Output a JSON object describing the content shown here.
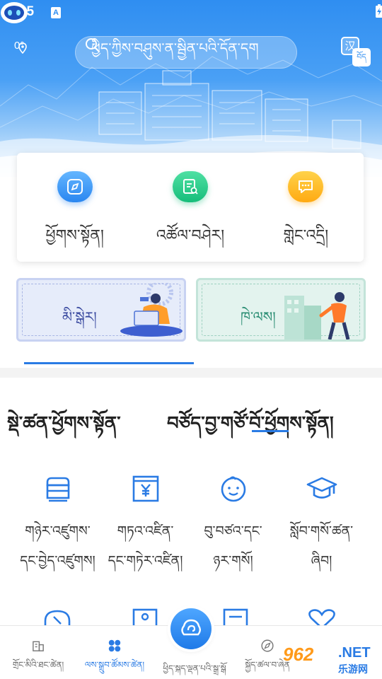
{
  "status_bar": {
    "time": "2:35",
    "app_icon_letter": "A"
  },
  "header": {
    "weather_temp": "0°",
    "search_placeholder": "ཕྱིད་ཀྱིས་བཤུས་ན་སྦྱིན་པའི་དོན་དག",
    "translate_zh": "汉",
    "translate_bo": "བོད"
  },
  "quick_access": [
    {
      "label": "ཕྱོགས་སྟོན།",
      "icon": "compass-icon"
    },
    {
      "label": "འཚོལ་བཤེར།",
      "icon": "document-search-icon"
    },
    {
      "label": "གླེང་འདྲི།",
      "icon": "chat-bubble-icon"
    }
  ],
  "banners": {
    "left_label": "མི་སྒེར།",
    "right_label": "ཁེ་ལས།"
  },
  "section_tabs": {
    "tab1": "སྡེ་ཚན་ཕྱོགས་སྟོན་",
    "tab2": "བཙོད་བྱ་གཙོ་བོ་ཕྱོགས་སྟོན།"
  },
  "services": [
    {
      "line1": "གཉེར་འཛུགས་",
      "line2": "དང་བྱེད་འཛུགས།",
      "icon": "storefront-icon"
    },
    {
      "line1": "གཏའ་འཛིན་",
      "line2": "དང་གཏེར་འཛིན།",
      "icon": "yuan-document-icon"
    },
    {
      "line1": "བུ་བཙའ་དང་",
      "line2": "ཉར་གསོ།",
      "icon": "baby-face-icon"
    },
    {
      "line1": "སློབ་གསོ་ཚན་",
      "line2": "ཞིབ།",
      "icon": "graduation-cap-icon"
    }
  ],
  "bottom_nav": {
    "item1": "གྲོང་མིའི་ཐང་ཚེན།",
    "item2": "ལས་སྒྲུབ་ཚོམས་ཚེན།",
    "center": "ཕྱིད་སྐད་ལྡན་པའི་སྒྲ་སྒོ",
    "item4": "སྐྱོད་ཚལ་བ་ཞེན"
  },
  "watermark": {
    "logo": "962",
    "net": ".NET",
    "sub": "乐游网"
  },
  "colors": {
    "primary": "#2a7be4",
    "hero_top": "#2f8ef1",
    "green": "#16bd7a",
    "orange": "#ffaa12"
  }
}
